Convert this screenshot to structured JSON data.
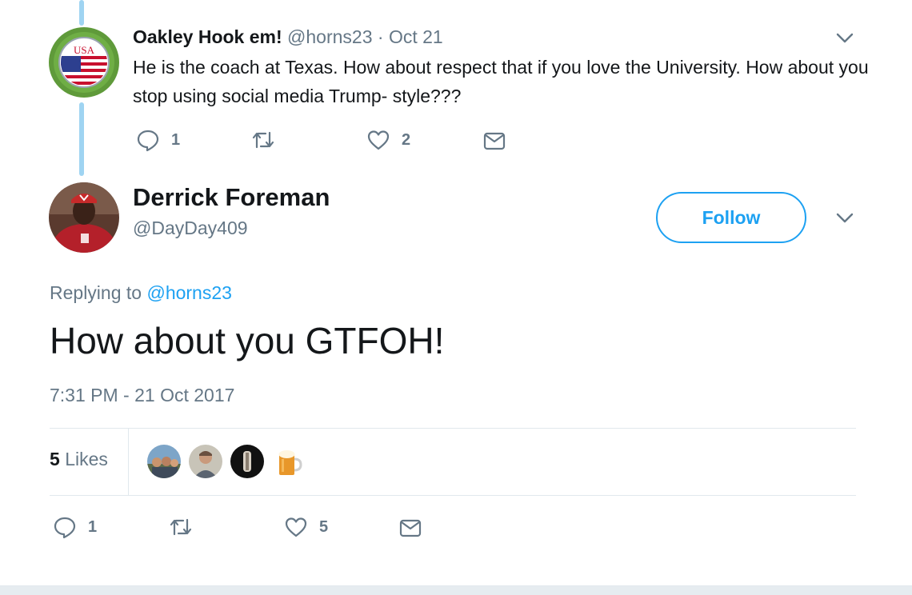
{
  "parent_tweet": {
    "name": "Oakley Hook em!",
    "handle": "@horns23",
    "separator": "·",
    "date": "Oct 21",
    "text": "He is the coach at Texas. How about respect that if you love the University. How about you stop using social media Trump- style???",
    "avatar_icon": "usa-flag-badge-avatar",
    "avatar_badge_text": "USA",
    "replies": "1",
    "likes": "2",
    "icons": [
      "reply-icon",
      "retweet-icon",
      "like-icon",
      "message-icon",
      "chevron-down-icon"
    ]
  },
  "main_tweet": {
    "name": "Derrick Foreman",
    "handle": "@DayDay409",
    "follow_label": "Follow",
    "replying_prefix": "Replying to",
    "replying_handle": "@horns23",
    "text": "How about you GTFOH!",
    "timestamp": "7:31 PM - 21 Oct 2017",
    "likes_count": "5",
    "likes_label": "Likes",
    "liker_avatars": [
      "group-photo-avatar",
      "man-portrait-avatar",
      "dark-silhouette-avatar",
      "beer-mug-avatar"
    ],
    "replies": "1",
    "like_count_action": "5"
  },
  "colors": {
    "accent": "#1da1f2",
    "muted": "#657786",
    "text": "#14171a",
    "thread_line": "#9fd4f2",
    "divider": "#e1e8ed"
  }
}
